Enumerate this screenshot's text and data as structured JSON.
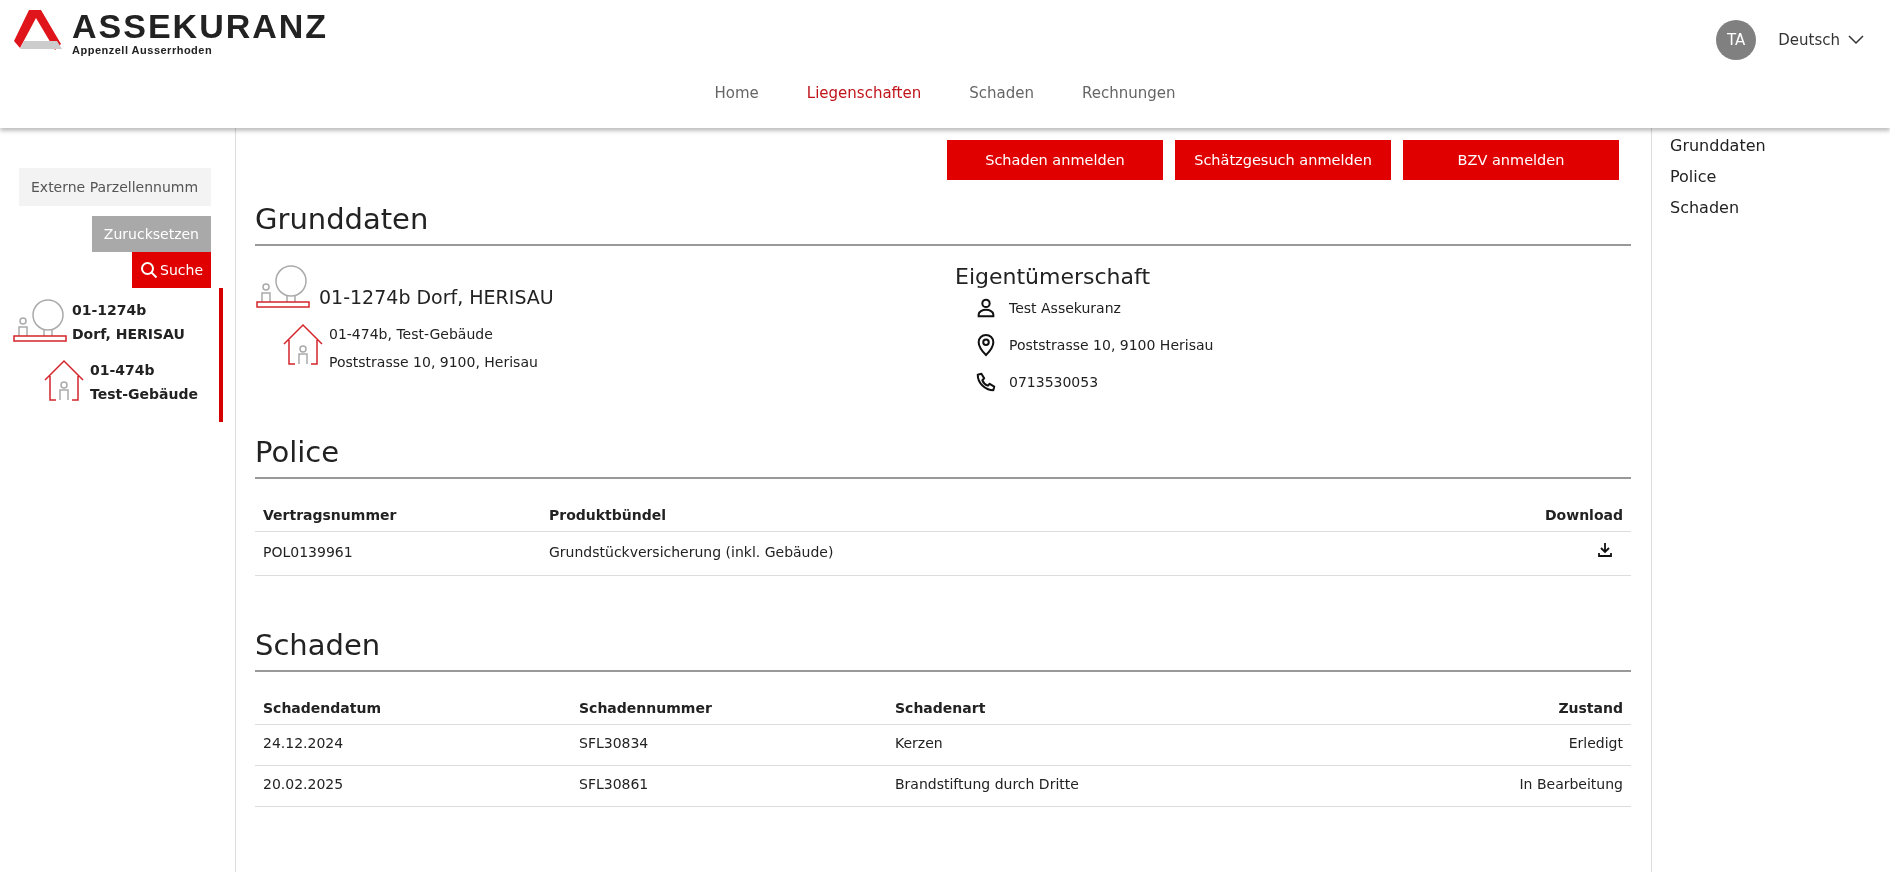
{
  "header": {
    "logo_title": "ASSEKURANZ",
    "logo_subtitle": "Appenzell Ausserrhoden",
    "avatar": "TA",
    "language": "Deutsch"
  },
  "nav": [
    {
      "label": "Home",
      "selected": false
    },
    {
      "label": "Liegenschaften",
      "selected": true
    },
    {
      "label": "Schaden",
      "selected": false
    },
    {
      "label": "Rechnungen",
      "selected": false
    }
  ],
  "sidebar": {
    "search": {
      "placeholder": "Externe Parzellennumm"
    },
    "reset_button": "Zurucksetzen",
    "search_button": "Suche",
    "tree": [
      {
        "kind": "parcel",
        "number": "01-1274b",
        "name": "Dorf, HERISAU",
        "children": [
          {
            "kind": "building",
            "number": "01-474b",
            "name": "Test-Gebäude"
          }
        ]
      }
    ]
  },
  "actions": [
    "Schaden anmelden",
    "Schätzgesuch anmelden",
    "BZV anmelden"
  ],
  "grunddaten": {
    "title": "Grunddaten",
    "parcel_title": "01-1274b Dorf, HERISAU",
    "building_line": "01-474b, Test-Gebäude",
    "building_address": "Poststrasse 10, 9100, Herisau",
    "owner_title": "Eigentümerschaft",
    "owner": [
      {
        "kind": "person",
        "text": "Test Assekuranz"
      },
      {
        "kind": "location",
        "text": "Poststrasse 10, 9100 Herisau"
      },
      {
        "kind": "phone",
        "text": "0713530053"
      }
    ]
  },
  "police": {
    "title": "Police",
    "columns": [
      "Vertragsnummer",
      "Produktbündel",
      "Download"
    ],
    "rows": [
      {
        "number": "POL0139961",
        "product": "Grundstückversicherung (inkl. Gebäude)"
      }
    ]
  },
  "schaden": {
    "title": "Schaden",
    "columns": [
      "Schadendatum",
      "Schadennummer",
      "Schadenart",
      "Zustand"
    ],
    "rows": [
      [
        "24.12.2024",
        "SFL30834",
        "Kerzen",
        "Erledigt"
      ],
      [
        "20.02.2025",
        "SFL30861",
        "Brandstiftung durch Dritte",
        "In Bearbeitung"
      ]
    ]
  },
  "toc": [
    "Grunddaten",
    "Police",
    "Schaden"
  ]
}
